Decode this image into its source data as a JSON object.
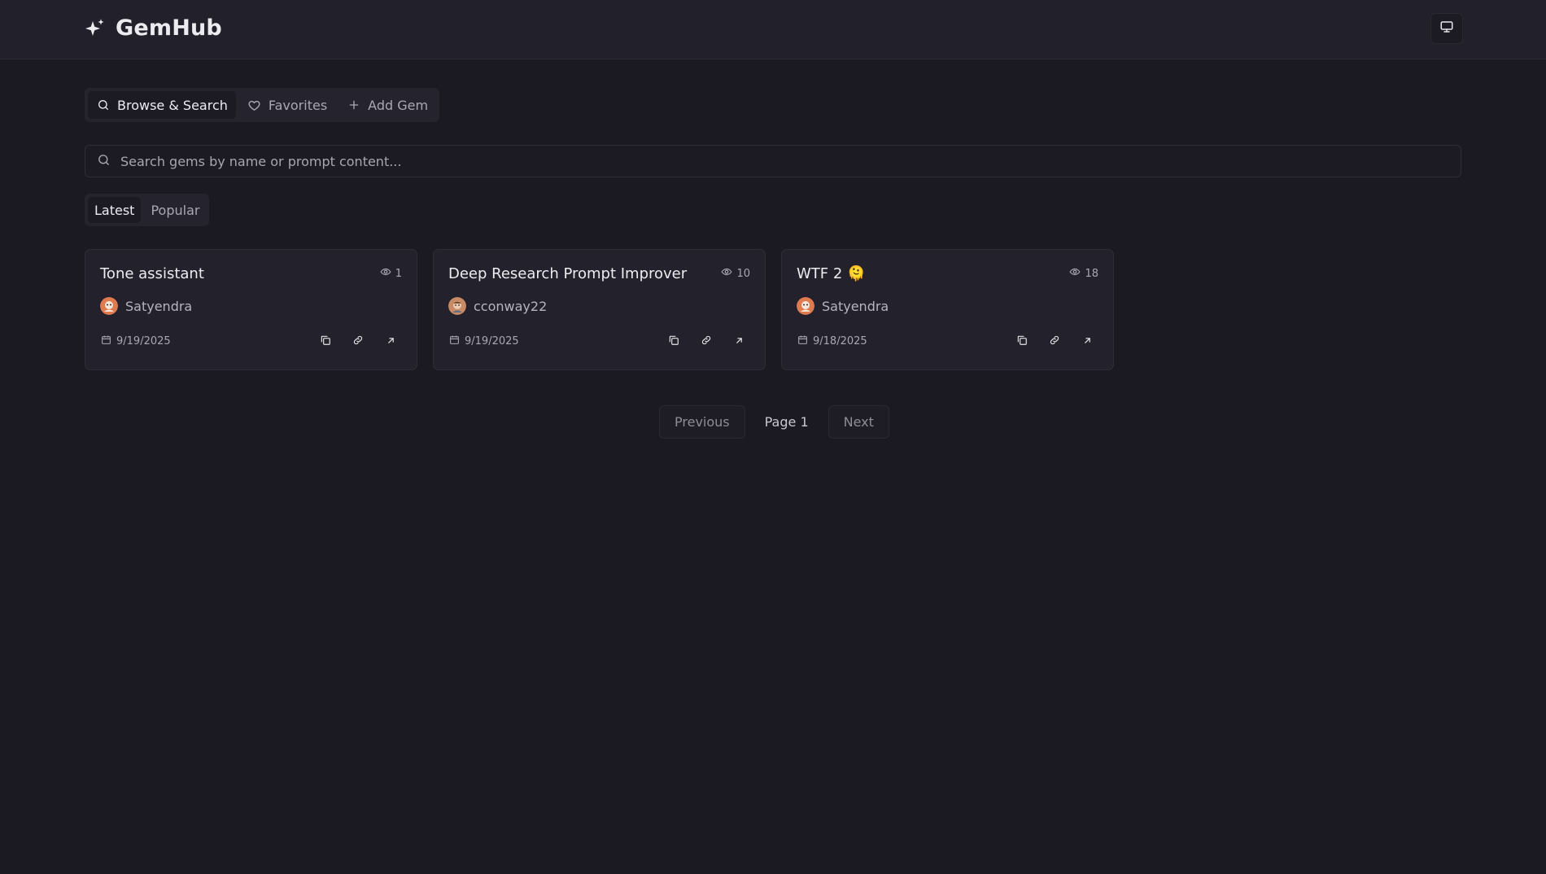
{
  "header": {
    "brand": "GemHub",
    "brand_icon": "sparkles-icon",
    "display_icon": "monitor-icon"
  },
  "tabs": [
    {
      "label": "Browse & Search",
      "icon": "search-icon",
      "active": true
    },
    {
      "label": "Favorites",
      "icon": "heart-icon",
      "active": false
    },
    {
      "label": "Add Gem",
      "icon": "plus-icon",
      "active": false
    }
  ],
  "search": {
    "placeholder": "Search gems by name or prompt content...",
    "value": ""
  },
  "sort": [
    {
      "label": "Latest",
      "active": true
    },
    {
      "label": "Popular",
      "active": false
    }
  ],
  "cards": [
    {
      "title": "Tone assistant",
      "views": "1",
      "author": "Satyendra",
      "date": "9/19/2025"
    },
    {
      "title": "Deep Research Prompt Improver",
      "views": "10",
      "author": "cconway22",
      "date": "9/19/2025"
    },
    {
      "title": "WTF 2 🫠",
      "views": "18",
      "author": "Satyendra",
      "date": "9/18/2025"
    }
  ],
  "card_actions": [
    "copy-icon",
    "link-icon",
    "arrow-up-right-icon"
  ],
  "pagination": {
    "previous": "Previous",
    "page": "Page 1",
    "next": "Next"
  },
  "colors": {
    "background": "#1b1a23",
    "header": "#22212b",
    "card": "#23222c",
    "text": "#ececf0",
    "muted": "#a9a8b2"
  }
}
